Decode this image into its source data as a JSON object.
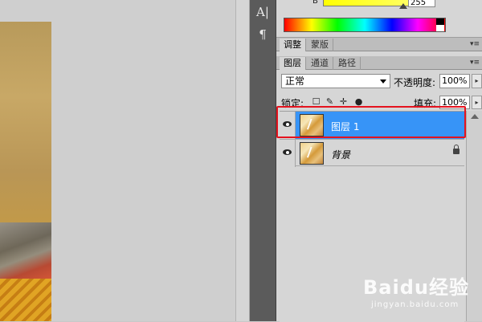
{
  "color_panel": {
    "channel_label": "B",
    "value": "255",
    "slider_color": "#ffff00"
  },
  "tools": [
    "A|",
    "¶"
  ],
  "adjust_tabs": [
    {
      "label": "调整",
      "active": true
    },
    {
      "label": "蒙版",
      "active": false
    }
  ],
  "layer_tabs": [
    {
      "label": "图层",
      "active": true
    },
    {
      "label": "通道",
      "active": false
    },
    {
      "label": "路径",
      "active": false
    }
  ],
  "panel_menu_glyph": "▾≡",
  "layers_panel": {
    "blend_mode": "正常",
    "opacity_label": "不透明度:",
    "opacity_value": "100%",
    "lock_label": "锁定:",
    "lock_icons": [
      "☐",
      "✎",
      "✛",
      "●"
    ],
    "fill_label": "填充:",
    "fill_value": "100%",
    "arrow_glyph": "▸"
  },
  "layers": [
    {
      "name": "图层 1",
      "visible": true,
      "selected": true,
      "locked": false
    },
    {
      "name": "背景",
      "visible": true,
      "selected": false,
      "locked": true
    }
  ],
  "colors": {
    "selection": "#3794f7",
    "highlight_box": "#e5131e"
  },
  "watermark": {
    "brand": "Baidu经验",
    "site": "jingyan.baidu.com"
  }
}
